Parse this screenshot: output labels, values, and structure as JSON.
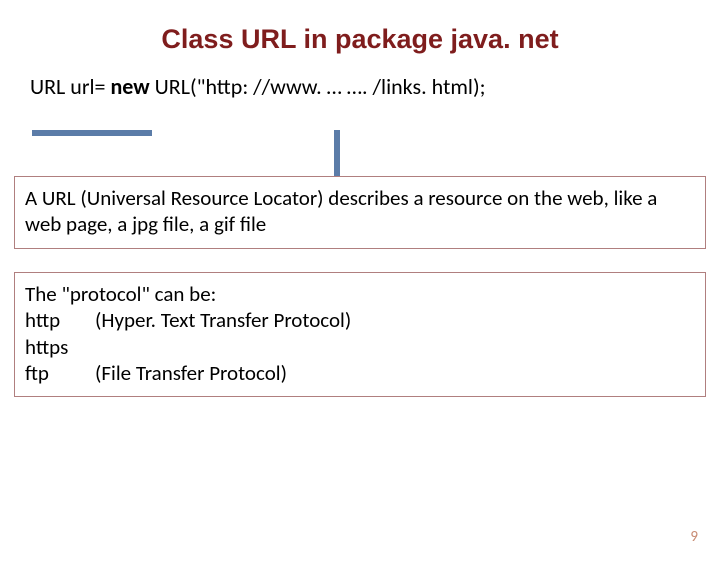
{
  "title": "Class URL in package java. net",
  "code": {
    "prefix": "URL url= ",
    "keyword": "new",
    "suffix": " URL(\"http: //www. … …. /links. html);"
  },
  "box1": "A URL (Universal Resource Locator) describes a resource on the web, like a web page, a jpg file, a gif file",
  "box2": {
    "heading": "The \"protocol\" can be:",
    "rows": [
      {
        "name": "http",
        "desc": "(Hyper. Text Transfer Protocol)"
      },
      {
        "name": "https",
        "desc": ""
      },
      {
        "name": "ftp",
        "desc": "(File Transfer Protocol)"
      }
    ]
  },
  "pageNumber": "9"
}
